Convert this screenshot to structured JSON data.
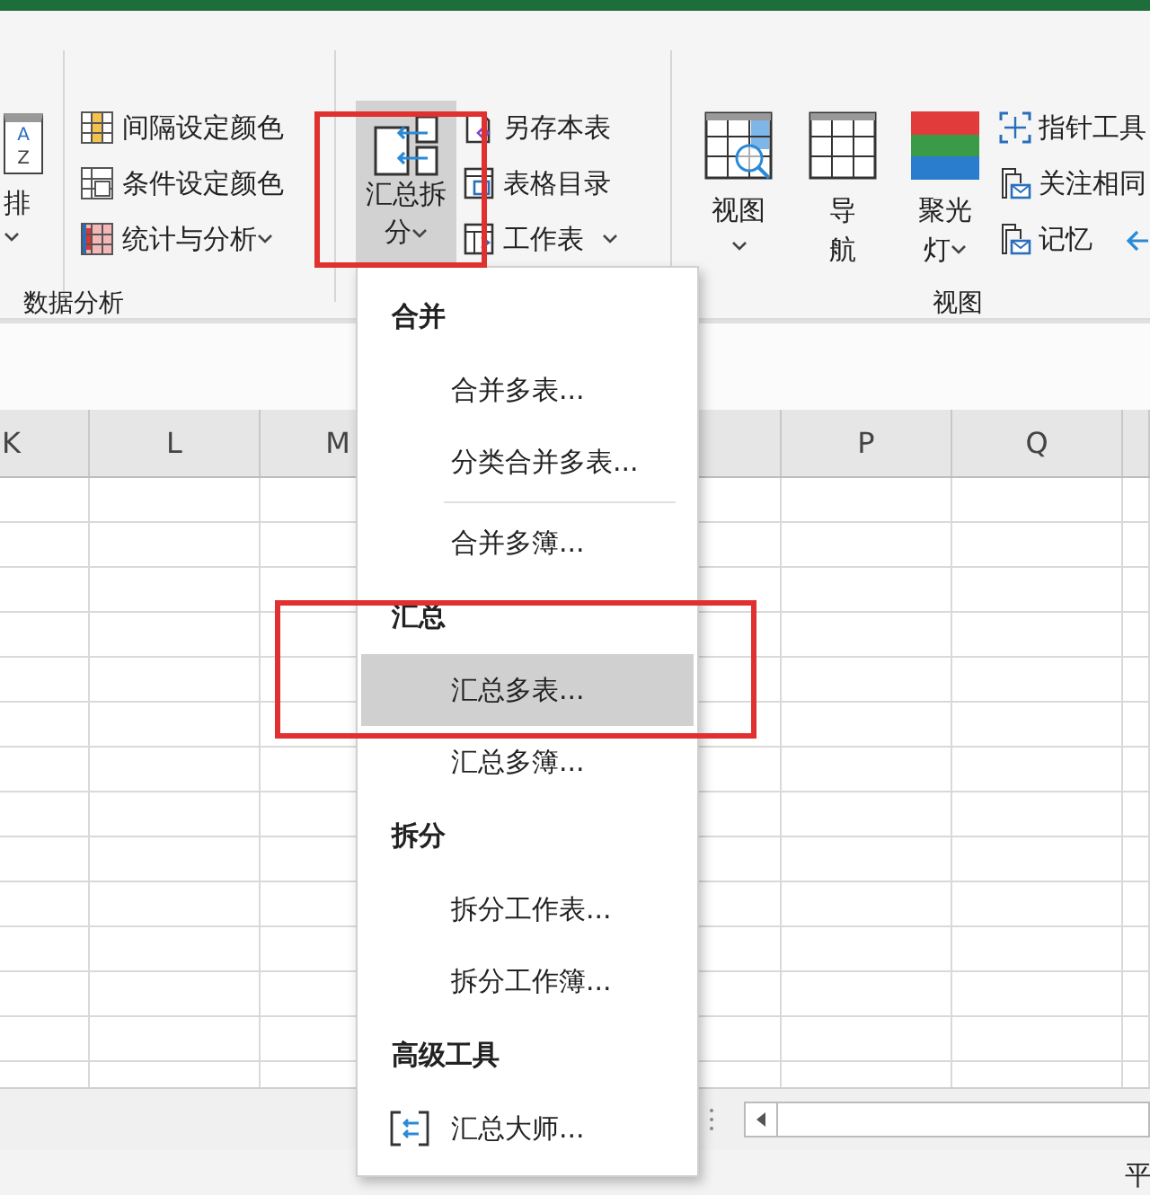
{
  "ribbon": {
    "sort_button": {
      "label": "排",
      "icon_letters": [
        "A",
        "Z"
      ],
      "dropdown": true
    },
    "data_group": {
      "label": "数据分析",
      "items": [
        {
          "label": "间隔设定颜色",
          "dropdown": false
        },
        {
          "label": "条件设定颜色",
          "dropdown": false
        },
        {
          "label": "统计与分析",
          "dropdown": true
        }
      ]
    },
    "summary_button": {
      "lines": [
        "汇总拆",
        "分"
      ],
      "dropdown": true,
      "pressed": true
    },
    "sheet_items": [
      {
        "label": "另存本表",
        "dropdown": false
      },
      {
        "label": "表格目录",
        "dropdown": false
      },
      {
        "label": "工作表",
        "dropdown": true
      }
    ],
    "view_buttons": [
      {
        "lines": [
          "视图"
        ],
        "dropdown": true
      },
      {
        "lines": [
          "导",
          "航"
        ],
        "dropdown": false
      },
      {
        "lines": [
          "聚光",
          "灯"
        ],
        "dropdown": true
      }
    ],
    "view_items": [
      {
        "label": "指针工具"
      },
      {
        "label": "关注相同"
      },
      {
        "label": "记忆"
      }
    ],
    "view_group_label": "视图"
  },
  "sheet": {
    "columns": [
      "K",
      "L",
      "M",
      "P",
      "Q"
    ]
  },
  "menu": {
    "items": [
      {
        "kind": "heading",
        "label": "合并"
      },
      {
        "kind": "item",
        "label": "合并多表...",
        "selected": false
      },
      {
        "kind": "item",
        "label": "分类合并多表...",
        "selected": false
      },
      {
        "kind": "separator"
      },
      {
        "kind": "item",
        "label": "合并多簿...",
        "selected": false
      },
      {
        "kind": "heading",
        "label": "汇总"
      },
      {
        "kind": "item",
        "label": "汇总多表...",
        "selected": true
      },
      {
        "kind": "item",
        "label": "汇总多簿...",
        "selected": false
      },
      {
        "kind": "heading",
        "label": "拆分"
      },
      {
        "kind": "item",
        "label": "拆分工作表...",
        "selected": false
      },
      {
        "kind": "item",
        "label": "拆分工作簿...",
        "selected": false
      },
      {
        "kind": "heading",
        "label": "高级工具"
      },
      {
        "kind": "icon_item",
        "label": "汇总大师...",
        "selected": false
      }
    ]
  },
  "status_bar": {
    "text": "平"
  }
}
